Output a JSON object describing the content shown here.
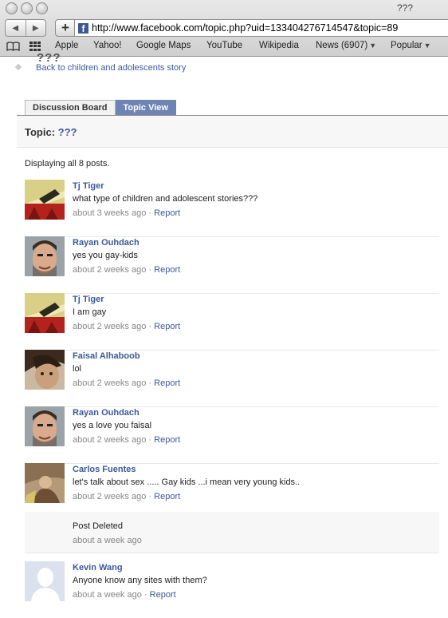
{
  "browser": {
    "window_title": "???",
    "url": "http://www.facebook.com/topic.php?uid=133404276714547&topic=89",
    "bookmarks": [
      "Apple",
      "Yahoo!",
      "Google Maps",
      "YouTube",
      "Wikipedia",
      "News (6907)",
      "Popular"
    ]
  },
  "page": {
    "header_dots": "???",
    "back_link": "Back to children and adolescents story",
    "tabs": [
      "Discussion Board",
      "Topic View"
    ],
    "topic_label": "Topic:",
    "topic_name": "???",
    "post_count": "Displaying all 8 posts.",
    "report_label": "Report",
    "separator": " · "
  },
  "posts": [
    {
      "author": "Tj Tiger",
      "text": "what type of children and adolescent stories???",
      "time": "about 3 weeks ago",
      "avatar": "tj-tiger-avatar"
    },
    {
      "author": "Rayan Ouhdach",
      "text": "yes you gay-kids",
      "time": "about 2 weeks ago",
      "avatar": "rayan-avatar"
    },
    {
      "author": "Tj Tiger",
      "text": "I am gay",
      "time": "about 2 weeks ago",
      "avatar": "tj-tiger-avatar"
    },
    {
      "author": "Faisal Alhaboob",
      "text": "lol",
      "time": "about 2 weeks ago",
      "avatar": "faisal-avatar"
    },
    {
      "author": "Rayan Ouhdach",
      "text": "yes a love you faisal",
      "time": "about 2 weeks ago",
      "avatar": "rayan-avatar"
    },
    {
      "author": "Carlos Fuentes",
      "text": "let's talk about sex ..... Gay kids ...i mean very young kids..",
      "time": "about 2 weeks ago",
      "avatar": "carlos-avatar"
    },
    {
      "author": "",
      "text": "Post Deleted",
      "time": "about a week ago",
      "avatar": ""
    },
    {
      "author": "Kevin Wang",
      "text": "Anyone know any sites with them?",
      "time": "about a week ago",
      "avatar": "default-silhouette-avatar"
    }
  ]
}
